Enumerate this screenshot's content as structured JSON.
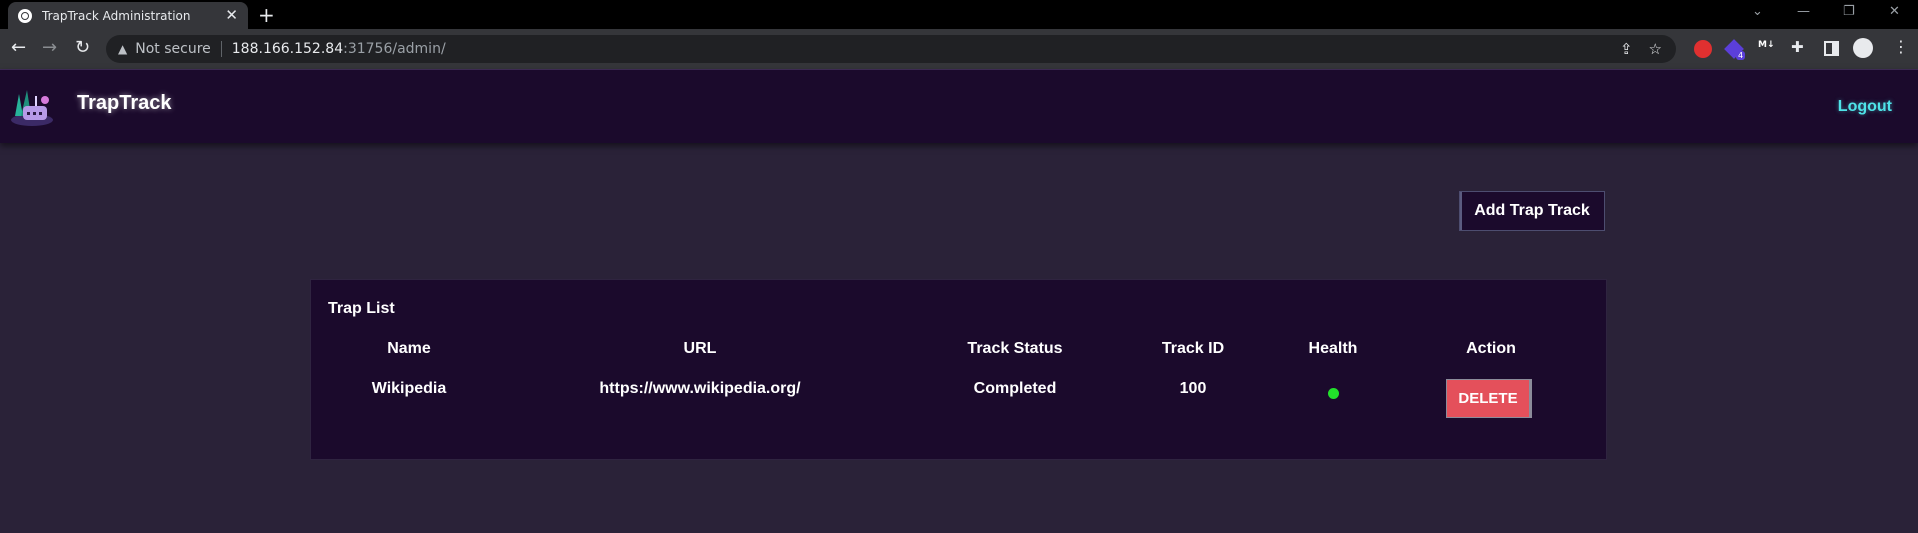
{
  "browser": {
    "tab_title": "TrapTrack Administration",
    "tab_close": "✕",
    "new_tab": "+",
    "security_label": "Not secure",
    "url_host": "188.166.152.84",
    "url_path": ":31756/admin/",
    "extension_badge": "4",
    "extension_m_label": "M↓"
  },
  "header": {
    "brand": "TrapTrack",
    "logout": "Logout"
  },
  "actions": {
    "add_label": "Add Trap Track"
  },
  "trap_list": {
    "title": "Trap List",
    "columns": [
      "Name",
      "URL",
      "Track Status",
      "Track ID",
      "Health",
      "Action"
    ],
    "rows": [
      {
        "name": "Wikipedia",
        "url": "https://www.wikipedia.org/",
        "status": "Completed",
        "track_id": "100",
        "health": "healthy",
        "action": "DELETE"
      }
    ]
  },
  "colors": {
    "header_bg": "#1b0a2c",
    "page_bg": "#2a2238",
    "logout": "#4fe3e8",
    "delete": "#e4505b",
    "health_ok": "#22e02b"
  }
}
